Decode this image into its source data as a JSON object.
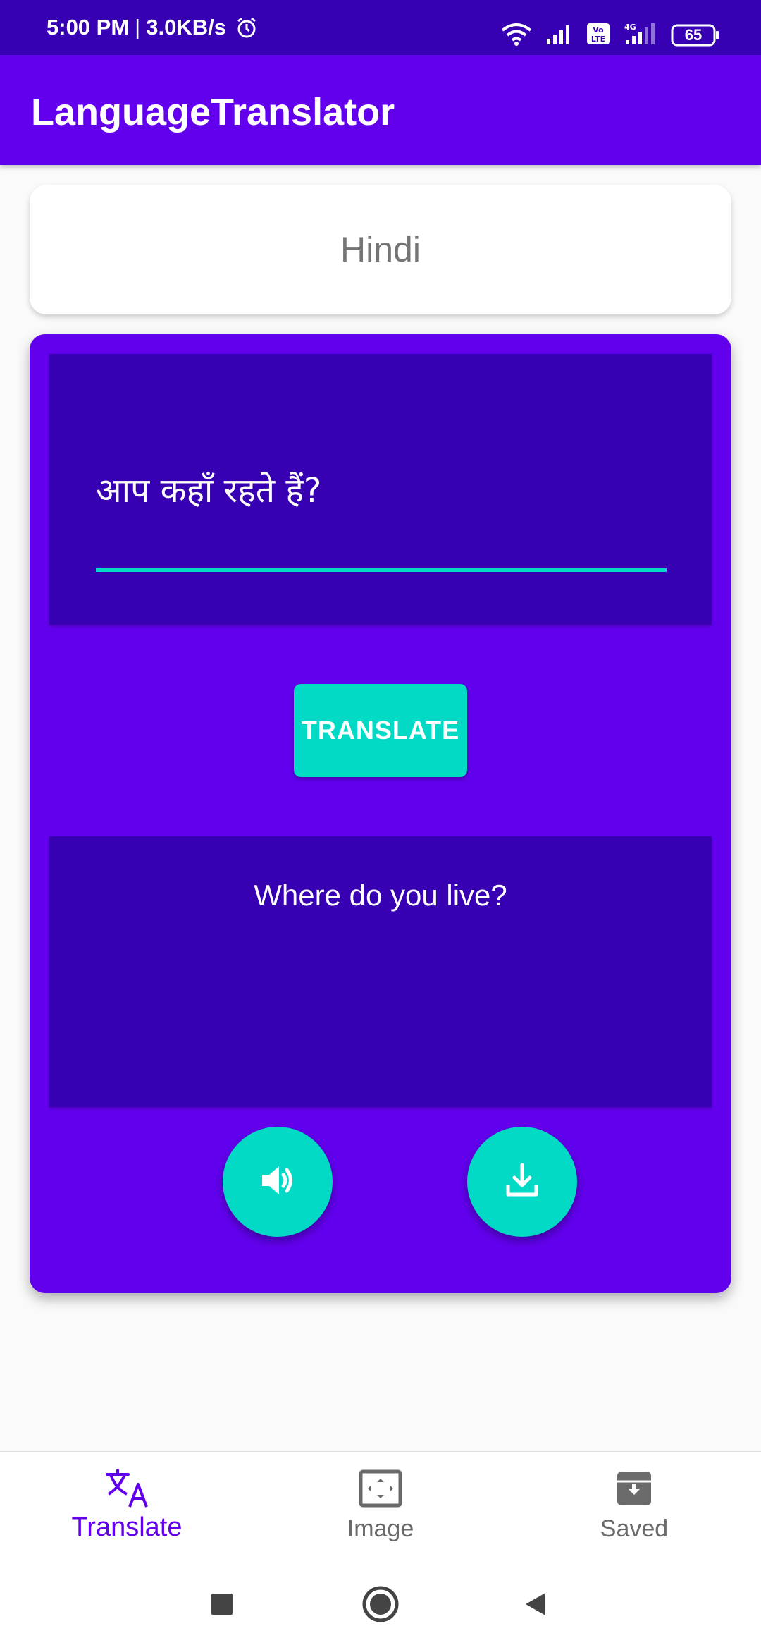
{
  "status_bar": {
    "time": "5:00 PM",
    "separator": "|",
    "speed": "3.0KB/s",
    "battery": "65",
    "icons": [
      "alarm-icon",
      "wifi-icon",
      "signal-icon",
      "volte-icon",
      "4g-signal-icon",
      "battery-icon"
    ]
  },
  "app_bar": {
    "title": "LanguageTranslator"
  },
  "language_selector": {
    "label": "Hindi"
  },
  "translator": {
    "input_text": "आप कहाँ रहते हैं?",
    "translate_button": "TRANSLATE",
    "output_text": "Where do you live?",
    "actions": [
      "speaker-icon",
      "download-icon"
    ]
  },
  "bottom_nav": {
    "items": [
      {
        "label": "Translate",
        "icon": "translate-icon",
        "active": true
      },
      {
        "label": "Image",
        "icon": "image-icon",
        "active": false
      },
      {
        "label": "Saved",
        "icon": "archive-icon",
        "active": false
      }
    ]
  },
  "system_nav": [
    "recents-button",
    "home-button",
    "back-button"
  ],
  "colors": {
    "primary": "#6200ee",
    "primary_dark": "#3700b3",
    "accent": "#03dac5",
    "inactive": "#6b6b6b"
  }
}
